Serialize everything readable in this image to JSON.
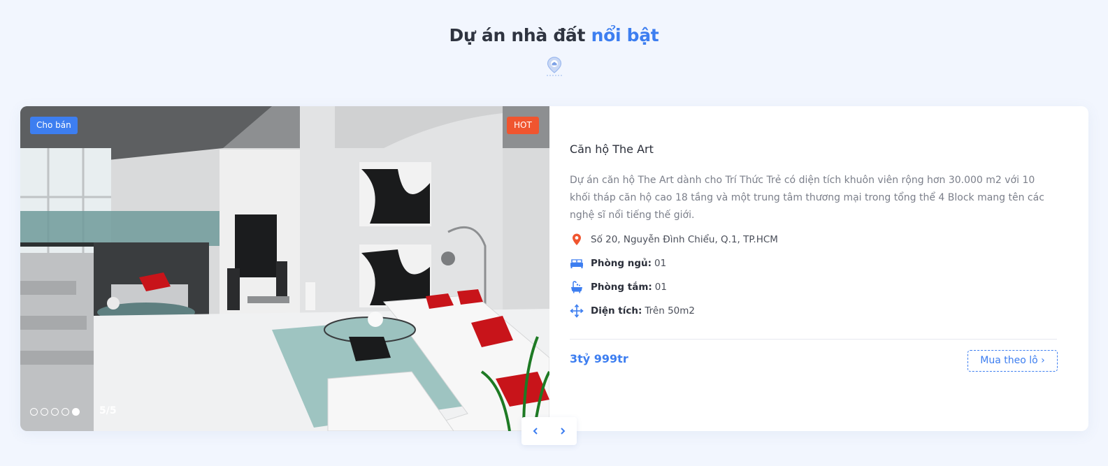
{
  "section": {
    "title_main": "Dự án nhà đất",
    "title_accent": "nổi bật",
    "icon": "location-pin-icon"
  },
  "project": {
    "badge_sale": "Cho bán",
    "badge_hot": "HOT",
    "slider_counter": "5/5",
    "slide_current": 5,
    "slide_total": 5,
    "name": "Căn hộ The Art",
    "description": "Dự án căn hộ The Art dành cho Trí Thức Trẻ có diện tích khuôn viên rộng hơn 30.000 m2 với 10 khối tháp căn hộ cao 18 tầng và một trung tâm thương mại trong tổng thể 4 Block mang tên các nghệ sĩ nổi tiếng thế giới.",
    "address": "Số 20, Nguyễn Đình Chiểu, Q.1, TP.HCM",
    "bedrooms_label": "Phòng ngủ:",
    "bedrooms_value": "01",
    "bathrooms_label": "Phòng tắm:",
    "bathrooms_value": "01",
    "area_label": "Diện tích:",
    "area_value": "Trên 50m2",
    "price": "3tỷ 999tr",
    "buy_button": "Mua theo lô ›"
  },
  "colors": {
    "accent": "#3d7ef0",
    "hot": "#f0552f",
    "background": "#f2f6fe"
  },
  "icons": [
    "location-pin-icon",
    "map-marker-icon",
    "bed-icon",
    "bathtub-icon",
    "move-arrows-icon",
    "chevron-left-icon",
    "chevron-right-icon"
  ]
}
